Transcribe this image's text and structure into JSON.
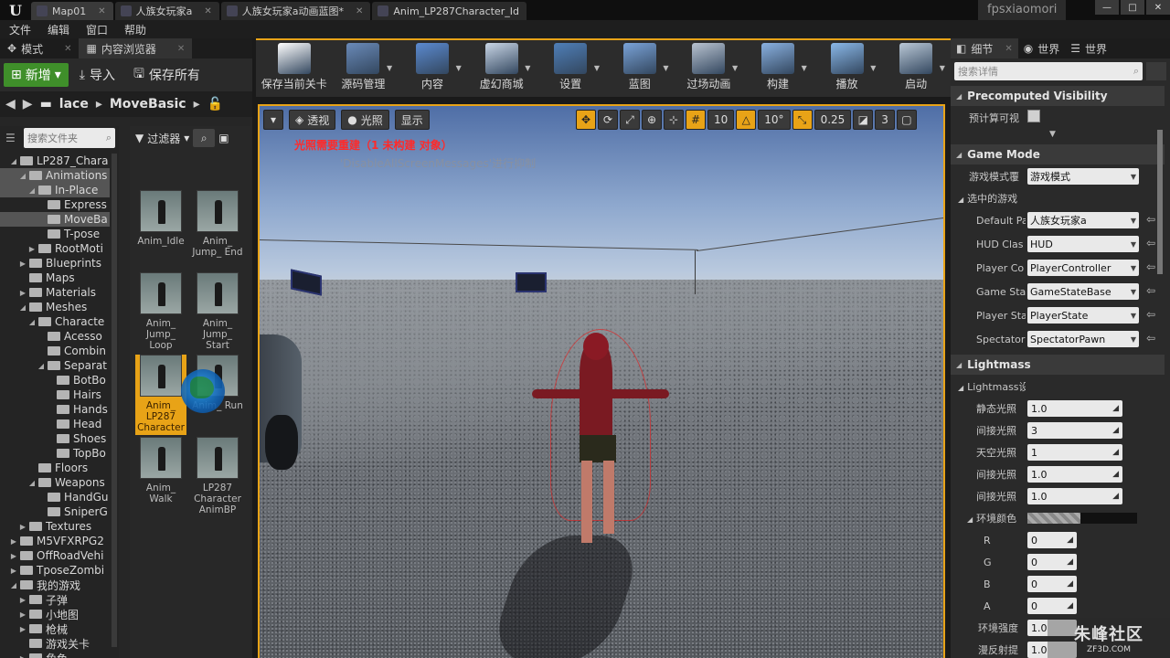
{
  "titlebar": {
    "tabs": [
      {
        "label": "Map01",
        "active": true
      },
      {
        "label": "人族女玩家a"
      },
      {
        "label": "人族女玩家a动画蓝图*"
      },
      {
        "label": "Anim_LP287Character_Id"
      }
    ],
    "project": "fpsxiaomori"
  },
  "menubar": [
    "文件",
    "编辑",
    "窗口",
    "帮助"
  ],
  "left": {
    "tabs": [
      {
        "label": "模式"
      },
      {
        "label": "内容浏览器"
      }
    ],
    "add_label": "新增",
    "import_label": "导入",
    "save_all_label": "保存所有",
    "breadcrumb": [
      "lace",
      "MoveBasic"
    ],
    "search_folder_placeholder": "搜索文件夹",
    "filter_label": "过滤器",
    "tree": [
      {
        "label": "LP287_Chara",
        "depth": 1,
        "open": true
      },
      {
        "label": "Animations",
        "depth": 2,
        "open": true,
        "sel": true
      },
      {
        "label": "In-Place",
        "depth": 3,
        "open": true,
        "sel": true
      },
      {
        "label": "Express",
        "depth": 4
      },
      {
        "label": "MoveBa",
        "depth": 4,
        "sel": true
      },
      {
        "label": "T-pose",
        "depth": 4
      },
      {
        "label": "RootMoti",
        "depth": 3,
        "closed": true
      },
      {
        "label": "Blueprints",
        "depth": 2,
        "closed": true
      },
      {
        "label": "Maps",
        "depth": 2
      },
      {
        "label": "Materials",
        "depth": 2,
        "closed": true
      },
      {
        "label": "Meshes",
        "depth": 2,
        "open": true
      },
      {
        "label": "Characte",
        "depth": 3,
        "open": true
      },
      {
        "label": "Acesso",
        "depth": 4
      },
      {
        "label": "Combin",
        "depth": 4
      },
      {
        "label": "Separat",
        "depth": 4,
        "open": true
      },
      {
        "label": "BotBo",
        "depth": 5
      },
      {
        "label": "Hairs",
        "depth": 5
      },
      {
        "label": "Hands",
        "depth": 5
      },
      {
        "label": "Head",
        "depth": 5
      },
      {
        "label": "Shoes",
        "depth": 5
      },
      {
        "label": "TopBo",
        "depth": 5
      },
      {
        "label": "Floors",
        "depth": 3
      },
      {
        "label": "Weapons",
        "depth": 3,
        "open": true
      },
      {
        "label": "HandGu",
        "depth": 4
      },
      {
        "label": "SniperG",
        "depth": 4
      },
      {
        "label": "Textures",
        "depth": 2,
        "closed": true
      },
      {
        "label": "M5VFXRPG2",
        "depth": 1,
        "closed": true
      },
      {
        "label": "OffRoadVehi",
        "depth": 1,
        "closed": true
      },
      {
        "label": "TposeZombi",
        "depth": 1,
        "closed": true
      },
      {
        "label": "我的游戏",
        "depth": 1,
        "open": true
      },
      {
        "label": "子弹",
        "depth": 2,
        "closed": true
      },
      {
        "label": "小地图",
        "depth": 2,
        "closed": true
      },
      {
        "label": "枪械",
        "depth": 2,
        "closed": true
      },
      {
        "label": "游戏关卡",
        "depth": 2
      },
      {
        "label": "角色",
        "depth": 2,
        "closed": true
      }
    ],
    "assets": [
      {
        "label": "Anim_Idle"
      },
      {
        "label": "Anim_ Jump_ End"
      },
      {
        "label": "Anim_ Jump_ Loop"
      },
      {
        "label": "Anim_ Jump_ Start"
      },
      {
        "label": "Anim_ LP287 Character",
        "selected": true
      },
      {
        "label": "Anim_ Run"
      },
      {
        "label": "Anim_ Walk"
      },
      {
        "label": "LP287 Character AnimBP"
      }
    ]
  },
  "main_toolbar": [
    {
      "label": "保存当前关卡",
      "icon": "save-icon",
      "color": "#ffffff"
    },
    {
      "label": "源码管理",
      "icon": "source-control-icon",
      "color": "#6a8ab8"
    },
    {
      "label": "内容",
      "icon": "content-icon",
      "color": "#5b8ad0"
    },
    {
      "label": "虚幻商城",
      "icon": "marketplace-icon",
      "color": "#c9d6e6"
    },
    {
      "label": "设置",
      "icon": "settings-icon",
      "color": "#4f7fb8"
    },
    {
      "label": "蓝图",
      "icon": "blueprint-icon",
      "color": "#7aa3d8"
    },
    {
      "label": "过场动画",
      "icon": "cinematics-icon",
      "color": "#b9c3d0"
    },
    {
      "label": "构建",
      "icon": "build-icon",
      "color": "#8ab1e0"
    },
    {
      "label": "播放",
      "icon": "play-icon",
      "color": "#8ab8e8"
    },
    {
      "label": "启动",
      "icon": "launch-icon",
      "color": "#bac8d6"
    }
  ],
  "viewport": {
    "perspective_label": "透视",
    "lit_label": "光照",
    "show_label": "显示",
    "grid_snap": "10",
    "rotate_snap": "10°",
    "scale_snap": "0.25",
    "camera_speed": "3",
    "warning": "光照需要重建（1 未构建 对象）",
    "note": "'DisableAllScreenMessages'进行抑制"
  },
  "right": {
    "tabs": [
      {
        "label": "细节"
      },
      {
        "label": "世界"
      },
      {
        "label": "世界"
      }
    ],
    "search_placeholder": "搜索详情",
    "precomputed_title": "Precomputed Visibility",
    "precomputed_label": "预计算可视",
    "game_mode_title": "Game Mode",
    "game_mode_override_label": "游戏模式覆",
    "game_mode_override_value": "游戏模式",
    "selected_game_label": "选中的游戏",
    "rows": [
      {
        "label": "Default Pa",
        "value": "人族女玩家a"
      },
      {
        "label": "HUD Clas",
        "value": "HUD"
      },
      {
        "label": "Player Co",
        "value": "PlayerController"
      },
      {
        "label": "Game Sta",
        "value": "GameStateBase"
      },
      {
        "label": "Player Sta",
        "value": "PlayerState"
      },
      {
        "label": "Spectator",
        "value": "SpectatorPawn"
      }
    ],
    "lightmass_title": "Lightmass",
    "lightmass_sub": "Lightmass设",
    "lightmass_rows": [
      {
        "label": "静态光照",
        "value": "1.0"
      },
      {
        "label": "间接光照",
        "value": "3"
      },
      {
        "label": "天空光照",
        "value": "1"
      },
      {
        "label": "间接光照",
        "value": "1.0"
      },
      {
        "label": "间接光照",
        "value": "1.0"
      }
    ],
    "env_color_label": "环境颜色",
    "rgba_rows": [
      {
        "label": "R",
        "value": "0"
      },
      {
        "label": "G",
        "value": "0"
      },
      {
        "label": "B",
        "value": "0"
      },
      {
        "label": "A",
        "value": "0"
      }
    ],
    "env_intensity_label": "环境强度",
    "env_intensity_value": "1.0",
    "diffuse_label": "漫反射提",
    "diffuse_value": "1.0"
  },
  "watermark": {
    "line1": "朱峰社区",
    "line2": "ZF3D.COM"
  }
}
